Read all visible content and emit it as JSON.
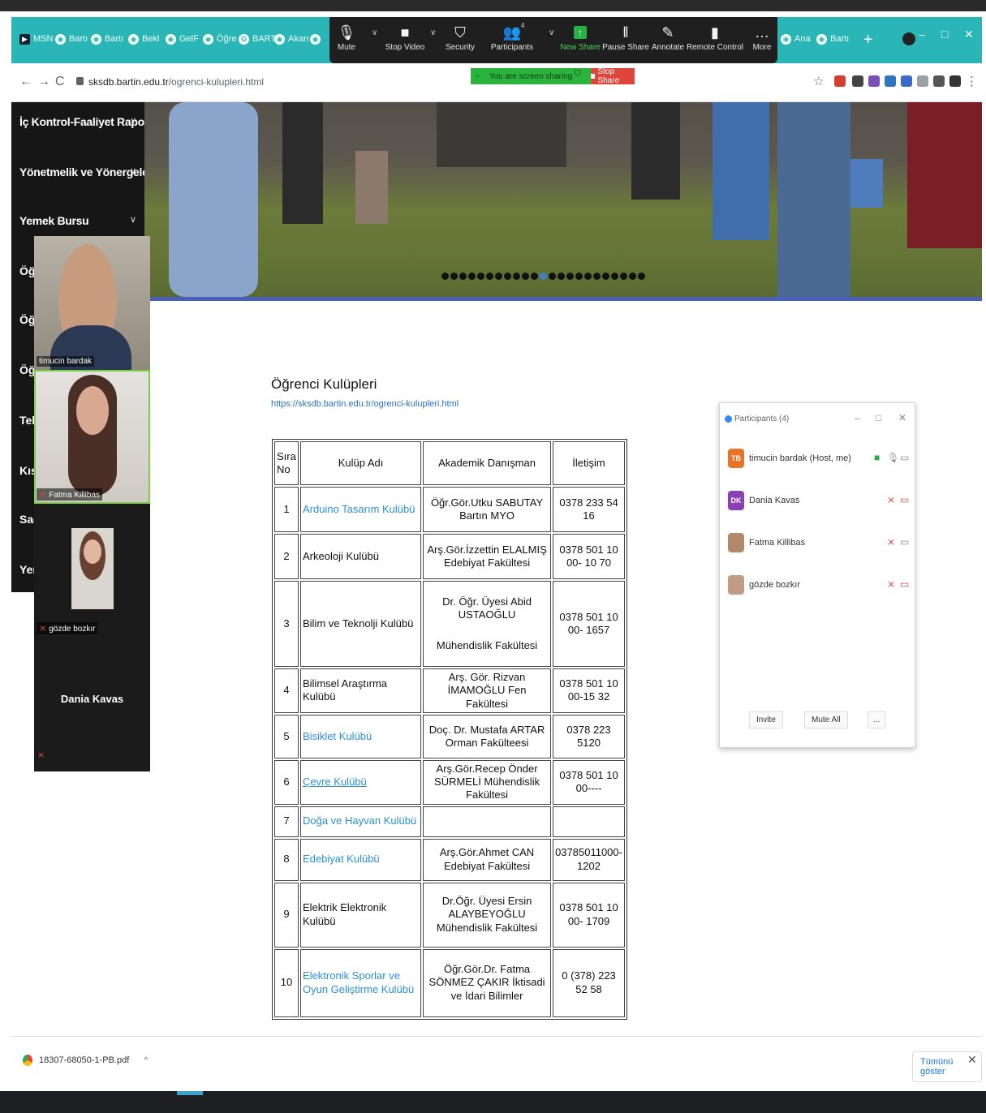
{
  "browser": {
    "tabs": [
      {
        "label": "MSN",
        "icon": "msn-icon"
      },
      {
        "label": "Bartı",
        "icon": "site-icon"
      },
      {
        "label": "Bartı",
        "icon": "site-icon"
      },
      {
        "label": "Bekl",
        "icon": "site-icon"
      },
      {
        "label": "GelF",
        "icon": "site-icon"
      },
      {
        "label": "Öğre",
        "icon": "site-icon"
      },
      {
        "label": "BART",
        "icon": "google-icon"
      },
      {
        "label": "Akarı",
        "icon": "site-icon"
      },
      {
        "label": "Ana",
        "icon": "site-icon"
      },
      {
        "label": "Bartı",
        "icon": "site-icon"
      }
    ],
    "url_host": "sksdb.bartin.edu.tr",
    "url_path": "/ogrenci-kulupleri.html"
  },
  "zoom": {
    "buttons": {
      "mute": "Mute",
      "stop_video": "Stop Video",
      "security": "Security",
      "participants": "Participants",
      "participants_count": "4",
      "new_share": "New Share",
      "pause_share": "Pause Share",
      "annotate": "Annotate",
      "remote_control": "Remote Control",
      "more": "More"
    },
    "sharing_text": "You are screen sharing",
    "stop_share": "Stop Share"
  },
  "sidebar": {
    "items": [
      {
        "label": "İç Kontrol-Faaliyet Rapori..."
      },
      {
        "label": "Yönetmelik ve Yönergeler"
      },
      {
        "label": "Yemek Bursu"
      }
    ],
    "stubs": [
      "Öğ",
      "Öğ",
      "Öğ",
      "Tek",
      "Kısı",
      "Sağ",
      "Yer"
    ]
  },
  "content": {
    "title": "Öğrenci Kulüpleri",
    "link": "https://sksdb.bartin.edu.tr/ogrenci-kulupleri.html",
    "table": {
      "headers": {
        "no": "Sıra No",
        "name": "Kulüp Adı",
        "advisor": "Akademik Danışman",
        "contact": "İletişim"
      },
      "rows": [
        {
          "no": "1",
          "name": "Arduino Tasarım Kulübü",
          "advisor": "Öğr.Gör.Utku SABUTAY Bartın MYO",
          "contact": "0378 233 54 16"
        },
        {
          "no": "2",
          "name": "Arkeoloji Kulübü",
          "advisor": "Arş.Gör.İzzettin ELALMIŞ Edebiyat Fakültesi",
          "contact": "0378 501 10 00- 10 70"
        },
        {
          "no": "3",
          "name": "Bilim ve Teknolji Kulübü",
          "advisor": "Dr. Öğr. Üyesi Abid USTAOĞLU",
          "advisor2": "Mühendislik Fakültesi",
          "contact": "0378 501 10 00- 1657"
        },
        {
          "no": "4",
          "name": "Bilimsel Araştırma Kulübü",
          "advisor": "Arş. Gör. Rizvan İMAMOĞLU Fen Fakültesi",
          "contact": "0378 501 10 00-15 32"
        },
        {
          "no": "5",
          "name": "Bisiklet Kulübü",
          "advisor": "Doç. Dr. Mustafa ARTAR Orman Fakülteesi",
          "contact": "0378 223 5120"
        },
        {
          "no": "6",
          "name": "Çevre Kulübü",
          "advisor": "Arş.Gör.Recep Önder SÜRMELİ Mühendislik Fakültesi",
          "contact": "0378 501 10 00----"
        },
        {
          "no": "7",
          "name": "Doğa ve Hayvan Kulübü",
          "advisor": "",
          "contact": ""
        },
        {
          "no": "8",
          "name": "Edebiyat Kulübü",
          "advisor": "Arş.Gör.Ahmet CAN Edebiyat Fakültesi",
          "contact": "03785011000-1202"
        },
        {
          "no": "9",
          "name": "Elektrik Elektronik Kulübü",
          "advisor": "Dr.Öğr. Üyesi Ersin ALAYBEYOĞLU Mühendislik Fakültesi",
          "contact": "0378 501 10 00- 1709"
        },
        {
          "no": "10",
          "name": "Elektronik Sporlar ve Oyun Geliştirme Kulübü",
          "advisor": "Öğr.Gör.Dr. Fatma SÖNMEZ ÇAKIR İktisadi ve İdari Bilimler",
          "contact": "0 (378) 223 52 58"
        }
      ]
    }
  },
  "participants_panel": {
    "title": "Participants (4)",
    "people": [
      {
        "initials": "TB",
        "name": "timucin bardak (Host, me)",
        "color": "#e8742a"
      },
      {
        "initials": "DK",
        "name": "Dania Kavas",
        "color": "#8a3fb7"
      },
      {
        "initials": "",
        "name": "Fatma Killibas",
        "color": "#b28a6b"
      },
      {
        "initials": "",
        "name": "gözde bozkır",
        "color": "#c29b84"
      }
    ],
    "invite": "Invite",
    "mute_all": "Mute All",
    "more": "..."
  },
  "video_tiles": [
    {
      "name": "timucin bardak"
    },
    {
      "name": "Fatma Killibas"
    },
    {
      "name": "gözde bozkır"
    },
    {
      "name": "Dania Kavas"
    }
  ],
  "downloads": {
    "file": "18307-68050-1-PB.pdf",
    "show_all": "Tümünü göster"
  }
}
